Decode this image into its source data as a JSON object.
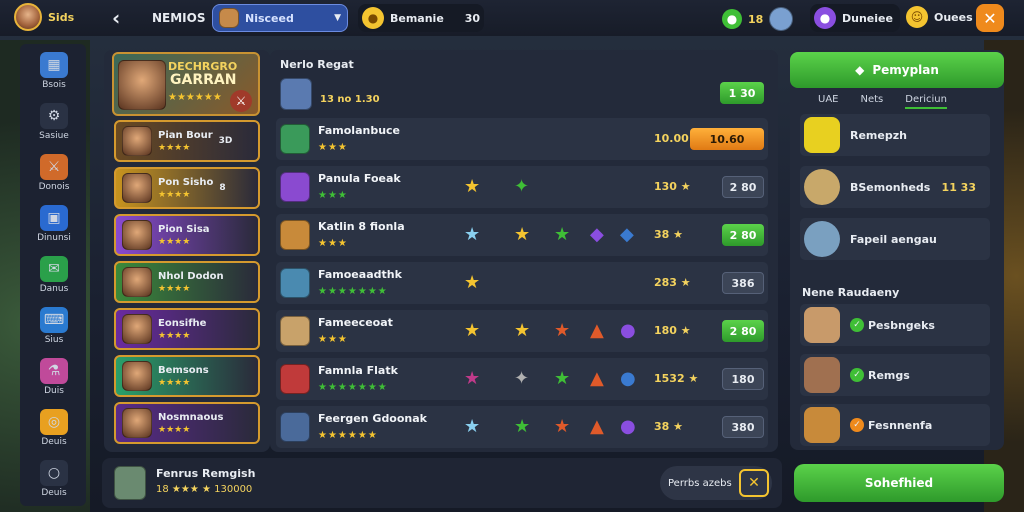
{
  "topbar": {
    "player_name": "Sids",
    "screen_title": "NEMIOS",
    "selector_label": "Nisceed",
    "gold_label": "Bemanie",
    "gold_value": "30",
    "gem_value": "18",
    "currency_label": "Duneiee",
    "coin_label": "Ouees"
  },
  "sidebar": {
    "items": [
      {
        "label": "Bsois",
        "icon": "squares-icon"
      },
      {
        "label": "Sasiue",
        "icon": "gear-icon"
      },
      {
        "label": "Donois",
        "icon": "sword-icon"
      },
      {
        "label": "Dinunsi",
        "icon": "grid-icon"
      },
      {
        "label": "Danus",
        "icon": "chat-icon"
      },
      {
        "label": "Sius",
        "icon": "controller-icon"
      },
      {
        "label": "Duis",
        "icon": "potion-icon"
      },
      {
        "label": "Deuis",
        "icon": "ring-icon"
      },
      {
        "label": "Deuis",
        "icon": "loop-icon"
      }
    ]
  },
  "banner": {
    "title_line1": "DECHRGRO",
    "title_line2": "GARRAN"
  },
  "cards": [
    {
      "name": "Pian Bour",
      "extra": "3D"
    },
    {
      "name": "Pon Sisho",
      "extra": "8"
    },
    {
      "name": "Pion Sisa",
      "extra": ""
    },
    {
      "name": "Nhol Dodon",
      "extra": ""
    },
    {
      "name": "Eonsifhe",
      "extra": ""
    },
    {
      "name": "Bemsons",
      "extra": ""
    },
    {
      "name": "Nosmnaous",
      "extra": ""
    }
  ],
  "list_header": {
    "title": "Nerlo Regat",
    "subtitle": "13 no 1.30",
    "button_label": "1 30"
  },
  "rows": [
    {
      "name": "Famolanbuce",
      "stars": "★★★",
      "value": "10.00",
      "button": "10.60",
      "button_style": "orange"
    },
    {
      "name": "Panula Foeak",
      "stars": "★★★",
      "value": "130 ★",
      "button": "2 80",
      "button_style": "gray"
    },
    {
      "name": "Katlin 8 fionla",
      "stars": "★★★",
      "value": "38 ★",
      "button": "2 80",
      "button_style": "green"
    },
    {
      "name": "Famoeaadthk",
      "stars": "★★★★★★★",
      "value": "283 ★",
      "button": "386",
      "button_style": "gray"
    },
    {
      "name": "Fameeceoat",
      "stars": "★★★",
      "value": "180 ★",
      "button": "2 80",
      "button_style": "green"
    },
    {
      "name": "Famnla Flatk",
      "stars": "★★★★★★★",
      "value": "1532 ★",
      "button": "180",
      "button_style": "gray"
    },
    {
      "name": "Feergen Gdoonak",
      "stars": "★★★★★★",
      "value": "38 ★",
      "button": "380",
      "button_style": "gray"
    }
  ],
  "right_panel": {
    "main_button": "Pemyplan",
    "tabs": [
      "UAE",
      "Nets",
      "Dericiun"
    ],
    "items": [
      {
        "name": "Remepzh",
        "value": ""
      },
      {
        "name": "BSemonheds",
        "value": "11 33"
      },
      {
        "name": "Fapeil aengau",
        "value": ""
      }
    ],
    "section_title": "Nene Raudaeny",
    "section_items": [
      "Pesbngeks",
      "Remgs",
      "Fesnnenfa"
    ]
  },
  "bottom": {
    "name": "Fenrus Remgish",
    "meta": "18 ★★★ ★ 130000",
    "right_label": "Perrbs azebs",
    "confirm_button": "Sohefhied"
  },
  "colors": {
    "accent_green": "#3fbf36",
    "accent_orange": "#ef8a1c",
    "gold": "#f4c430"
  }
}
